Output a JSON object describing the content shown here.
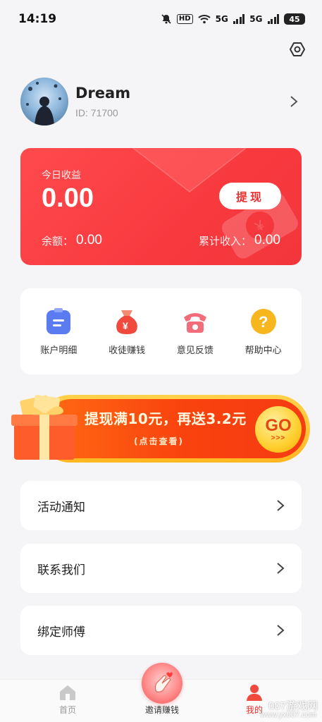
{
  "status_bar": {
    "time": "14:19",
    "hd_label": "HD",
    "network_label_1": "5G",
    "network_label_2": "5G",
    "battery": "45"
  },
  "profile": {
    "name": "Dream",
    "id_text": "ID: 71700"
  },
  "earnings": {
    "title": "今日收益",
    "amount": "0.00",
    "withdraw_label": "提现",
    "balance_label": "余额：",
    "balance_value": "0.00",
    "total_label": "累计收入：",
    "total_value": "0.00",
    "accent": "#f83a3f"
  },
  "quick_actions": [
    {
      "label": "账户明细",
      "icon": "document-icon",
      "color": "#5b7cf0"
    },
    {
      "label": "收徒赚钱",
      "icon": "money-bag-icon",
      "color": "#f0493e"
    },
    {
      "label": "意见反馈",
      "icon": "telephone-icon",
      "color": "#f26c7c"
    },
    {
      "label": "帮助中心",
      "icon": "question-icon",
      "color": "#f7b51e"
    }
  ],
  "promo": {
    "title": "提现满10元，再送3.2元",
    "subtitle": "(点击查看)",
    "go_label": "GO",
    "go_arrows": ">>>"
  },
  "menu": [
    {
      "label": "活动通知"
    },
    {
      "label": "联系我们"
    },
    {
      "label": "绑定师傅"
    }
  ],
  "bottom_nav": [
    {
      "label": "首页",
      "icon": "home-icon"
    },
    {
      "label": "邀请赚钱",
      "icon": "finger-heart-icon"
    },
    {
      "label": "我的",
      "icon": "user-icon",
      "active": true
    }
  ],
  "watermark": {
    "text": "007游戏网",
    "url": "www.yx007.com"
  }
}
